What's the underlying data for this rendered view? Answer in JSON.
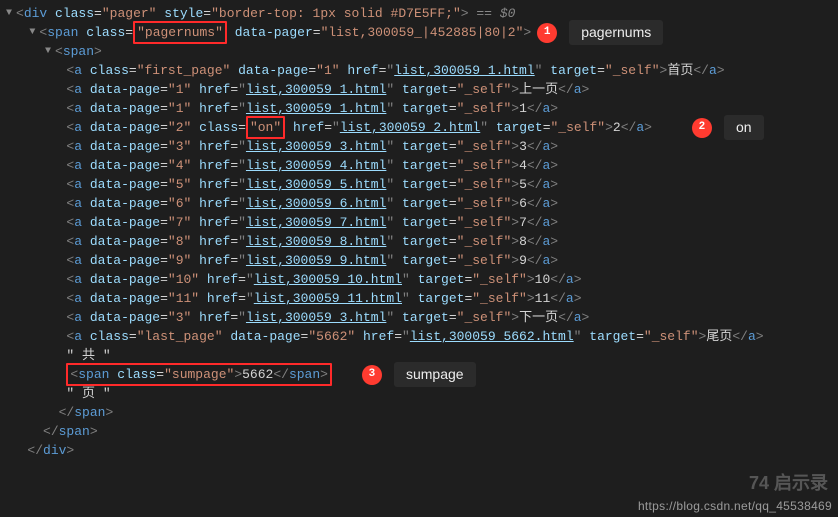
{
  "header": {
    "tag": "div",
    "class": "pager",
    "style": "border-top: 1px solid #D7E5FF;",
    "selected_indicator": "== $0"
  },
  "annotations": {
    "badge1": "1",
    "label1": "pagernums",
    "badge2": "2",
    "label2": "on",
    "badge3": "3",
    "label3": "sumpage"
  },
  "pagernums_span": {
    "tag": "span",
    "class_attr": "pagernums",
    "data_pager": "list,300059_|452885|80|2"
  },
  "inner_span_tag": "span",
  "links": [
    {
      "class": "first_page",
      "data_page": "1",
      "href": "list,300059_1.html",
      "target": "_self",
      "text": "首页"
    },
    {
      "class": "",
      "data_page": "1",
      "href": "list,300059_1.html",
      "target": "_self",
      "text": "上一页"
    },
    {
      "class": "",
      "data_page": "1",
      "href": "list,300059_1.html",
      "target": "_self",
      "text": "1"
    },
    {
      "class": "on",
      "data_page": "2",
      "href": "list,300059_2.html",
      "target": "_self",
      "text": "2"
    },
    {
      "class": "",
      "data_page": "3",
      "href": "list,300059_3.html",
      "target": "_self",
      "text": "3"
    },
    {
      "class": "",
      "data_page": "4",
      "href": "list,300059_4.html",
      "target": "_self",
      "text": "4"
    },
    {
      "class": "",
      "data_page": "5",
      "href": "list,300059_5.html",
      "target": "_self",
      "text": "5"
    },
    {
      "class": "",
      "data_page": "6",
      "href": "list,300059_6.html",
      "target": "_self",
      "text": "6"
    },
    {
      "class": "",
      "data_page": "7",
      "href": "list,300059_7.html",
      "target": "_self",
      "text": "7"
    },
    {
      "class": "",
      "data_page": "8",
      "href": "list,300059_8.html",
      "target": "_self",
      "text": "8"
    },
    {
      "class": "",
      "data_page": "9",
      "href": "list,300059_9.html",
      "target": "_self",
      "text": "9"
    },
    {
      "class": "",
      "data_page": "10",
      "href": "list,300059_10.html",
      "target": "_self",
      "text": "10"
    },
    {
      "class": "",
      "data_page": "11",
      "href": "list,300059_11.html",
      "target": "_self",
      "text": "11"
    },
    {
      "class": "",
      "data_page": "3",
      "href": "list,300059_3.html",
      "target": "_self",
      "text": "下一页"
    },
    {
      "class": "last_page",
      "data_page": "5662",
      "href": "list,300059_5662.html",
      "target": "_self",
      "text": "尾页"
    }
  ],
  "total_prefix": "\" 共 \"",
  "sumpage": {
    "tag": "span",
    "class": "sumpage",
    "text": "5662"
  },
  "total_suffix": "\" 页 \"",
  "close_tags": {
    "span": "span",
    "div": "div"
  },
  "watermark": "https://blog.csdn.net/qq_45538469",
  "logo": "74 启示录"
}
